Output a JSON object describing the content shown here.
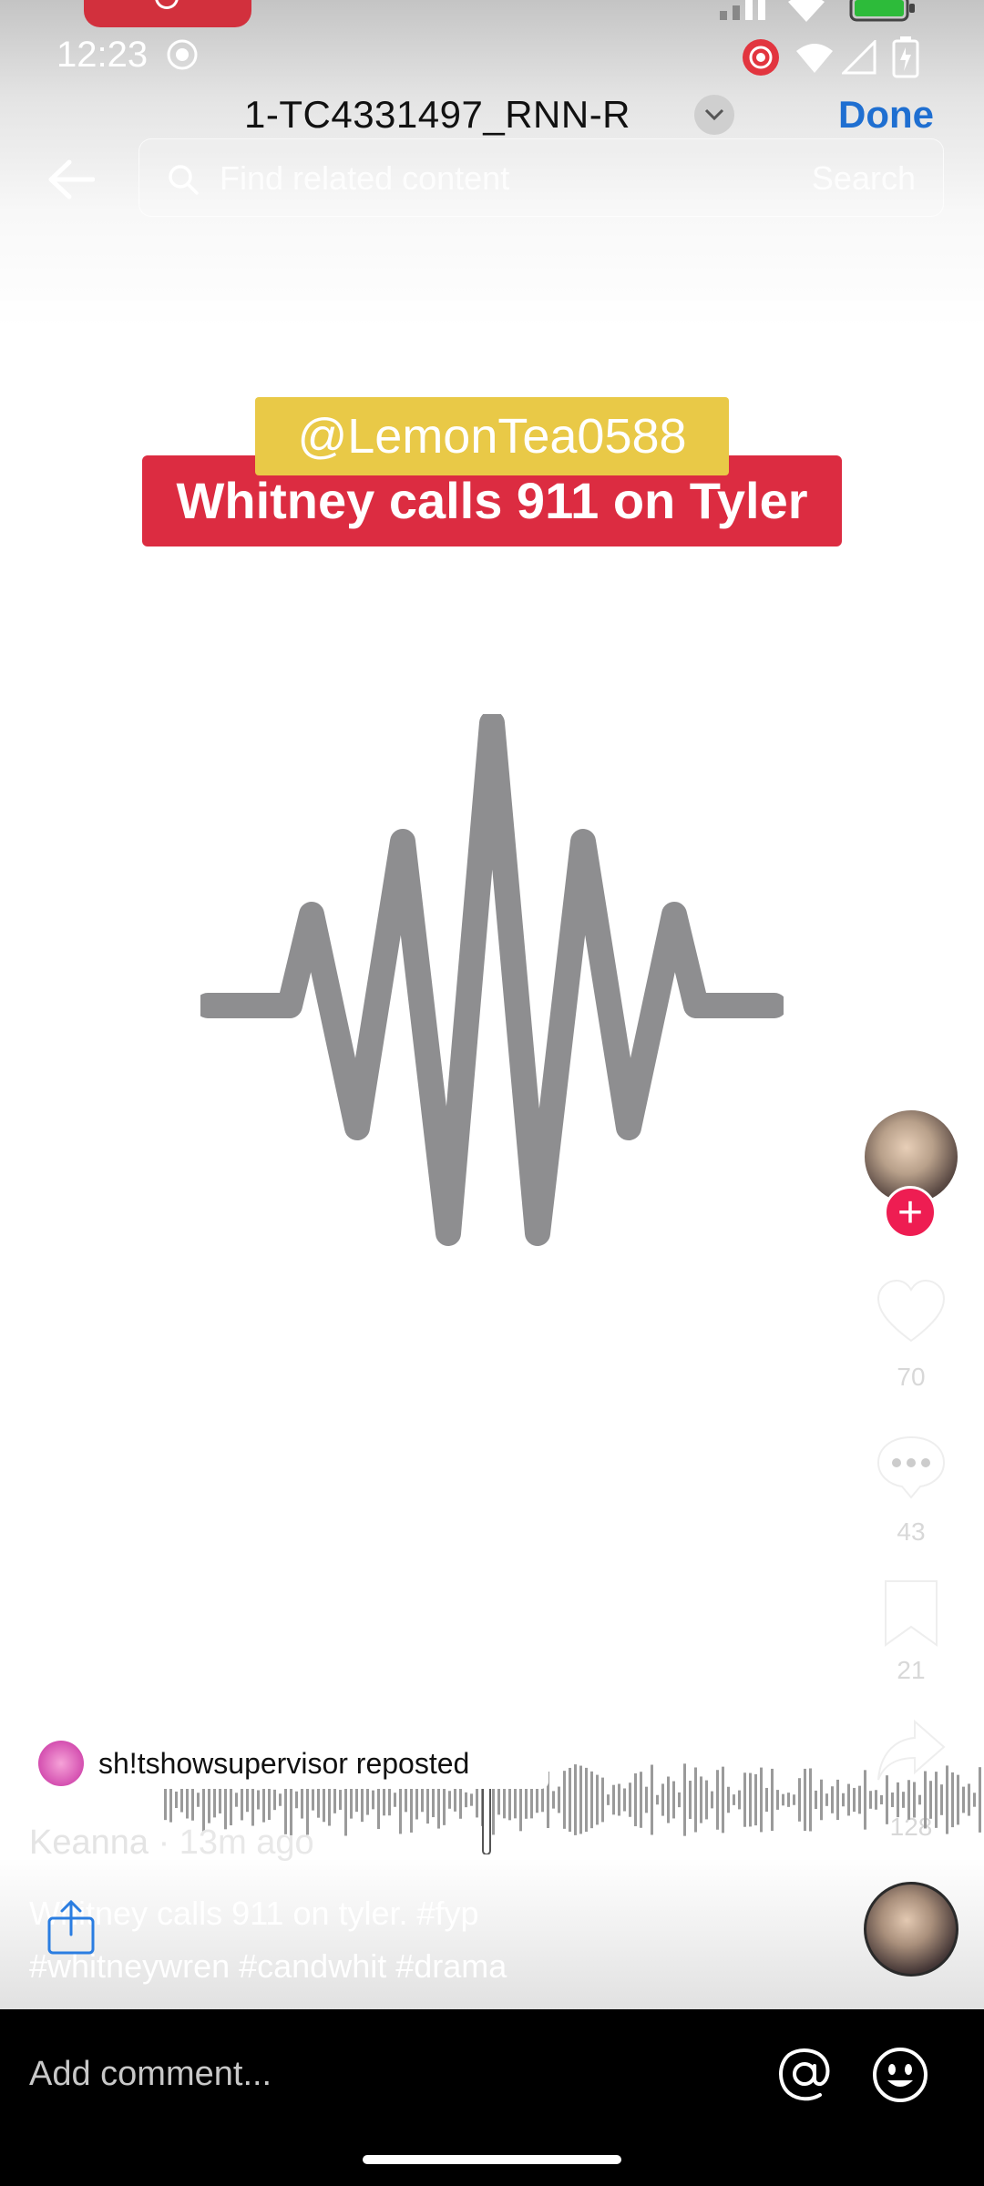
{
  "status_bar": {
    "time": "12:23"
  },
  "header": {
    "title": "1-TC4331497_RNN-R",
    "done_label": "Done",
    "search_placeholder": "Find related content",
    "search_label": "Search"
  },
  "video": {
    "overlay_user": "@LemonTea0588",
    "overlay_title": "Whitney calls 911 on Tyler"
  },
  "side_actions": {
    "likes": "70",
    "comments": "43",
    "favorites": "21",
    "shares": "128"
  },
  "post": {
    "repost_text": "sh!tshowsupervisor reposted",
    "author": "Keanna",
    "time_ago": "13m ago",
    "caption_line1": "Whitney calls 911 on tyler. #fyp",
    "caption_line2": "#whitneywren #candwhit #drama"
  },
  "comment_bar": {
    "placeholder": "Add comment..."
  },
  "icons": {
    "back": "back-arrow-icon",
    "search": "search-icon",
    "like": "heart-icon",
    "comment": "comment-icon",
    "favorite": "bookmark-icon",
    "share": "share-icon",
    "mention": "at-icon",
    "emoji": "emoji-icon"
  }
}
